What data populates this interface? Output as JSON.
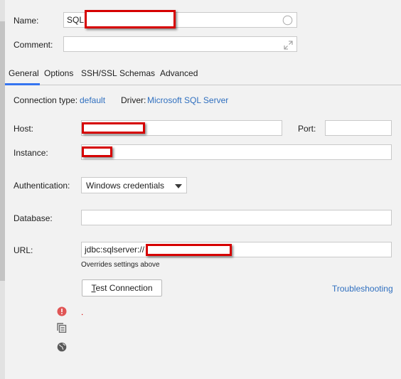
{
  "general": {
    "name_label": "Name:",
    "name_value": "SQL",
    "comment_label": "Comment:",
    "comment_value": ""
  },
  "tabs": [
    {
      "label": "General",
      "active": true
    },
    {
      "label": "Options"
    },
    {
      "label": "SSH/SSL"
    },
    {
      "label": "Schemas"
    },
    {
      "label": "Advanced"
    }
  ],
  "connection": {
    "type_label": "Connection type:",
    "type_value": "default",
    "driver_label": "Driver:",
    "driver_value": "Microsoft SQL Server"
  },
  "form": {
    "host_label": "Host:",
    "host_value": "",
    "port_label": "Port:",
    "port_value": "",
    "instance_label": "Instance:",
    "instance_value": "",
    "auth_label": "Authentication:",
    "auth_value": "Windows credentials",
    "database_label": "Database:",
    "database_value": "",
    "url_label": "URL:",
    "url_value": "jdbc:sqlserver://",
    "url_hint": "Overrides settings above"
  },
  "actions": {
    "test_connection": "Test Connection",
    "troubleshooting": "Troubleshooting",
    "status_message": "."
  },
  "icons": {
    "error": "error-icon",
    "copy": "copy-icon",
    "globe": "globe-icon",
    "expand": "expand-icon",
    "circle": "circle-icon",
    "dropdown": "chevron-down-icon"
  },
  "colors": {
    "accent": "#3574f0",
    "link": "#2f6fbf",
    "error": "#e05555",
    "redaction": "#d60000"
  }
}
